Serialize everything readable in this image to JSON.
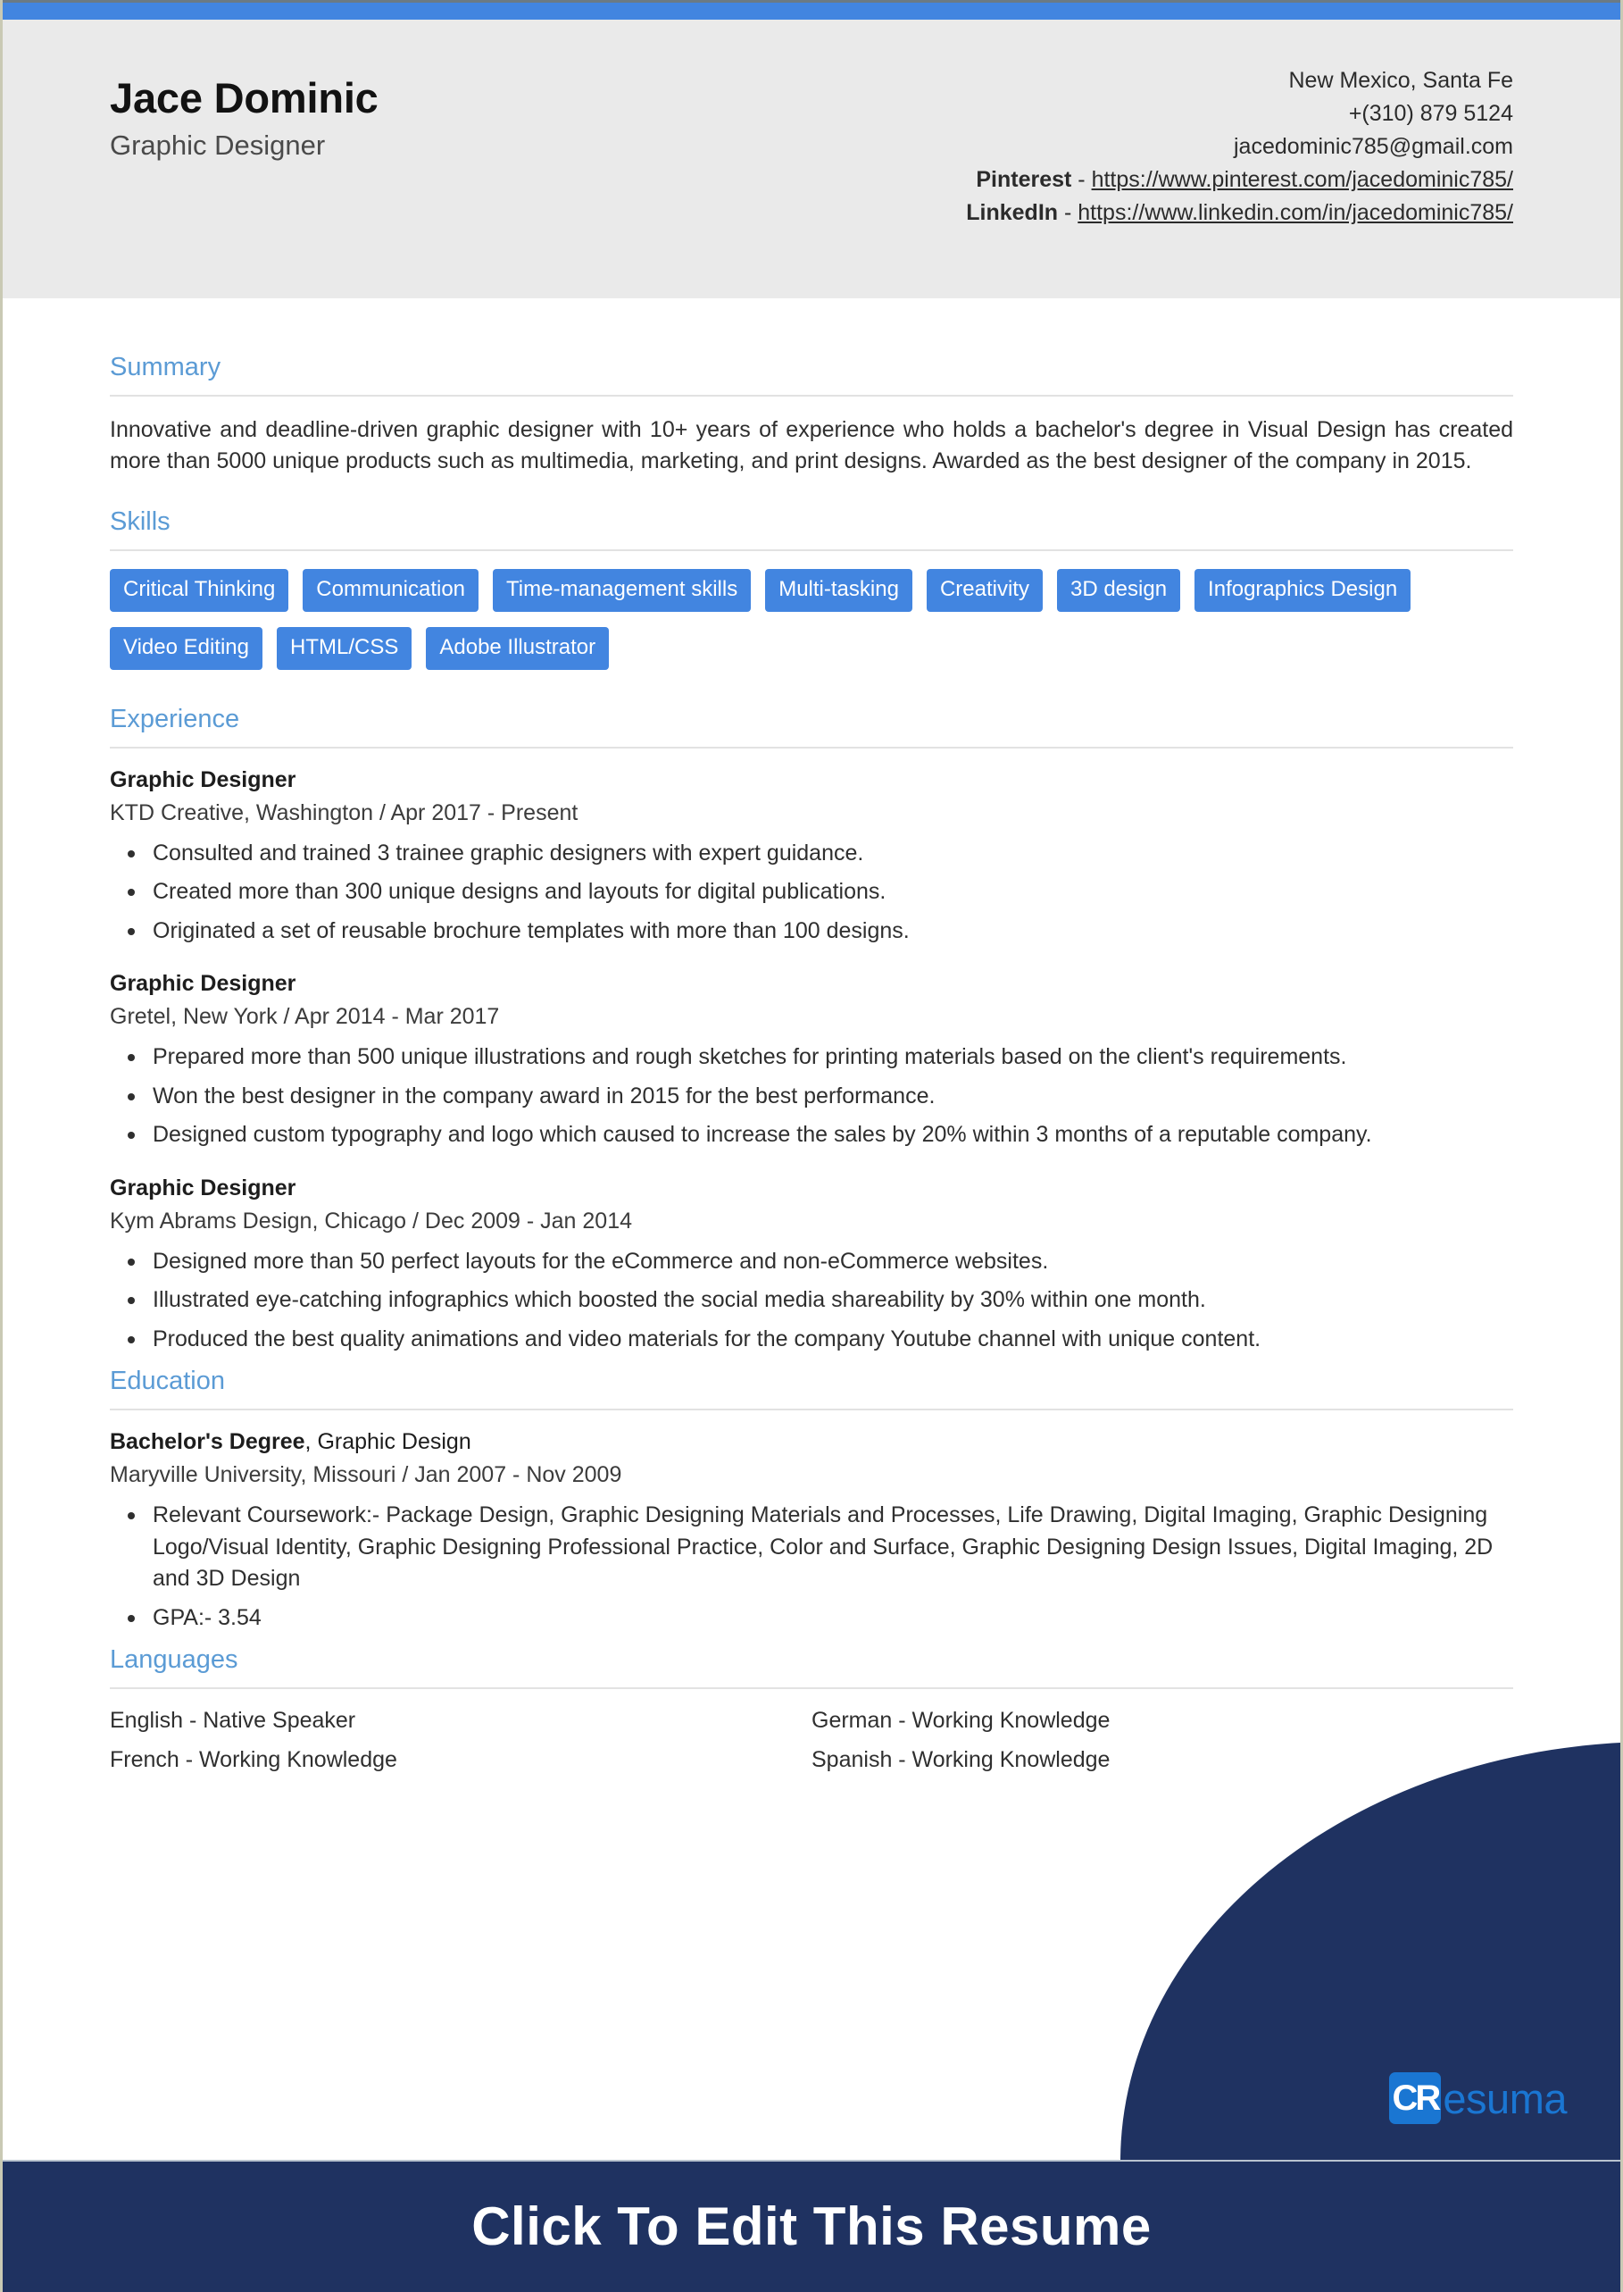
{
  "theme": {
    "accent_blue": "#4285e0",
    "heading_blue": "#5b9bd5",
    "navy": "#1f3261",
    "logo_blue": "#1a76d2",
    "header_band_bg": "#eaeaea"
  },
  "header": {
    "full_name": "Jace Dominic",
    "job_title": "Graphic Designer",
    "location": "New Mexico, Santa Fe",
    "phone": "+(310) 879 5124",
    "email": "jacedominic785@gmail.com",
    "pinterest_label": "Pinterest",
    "pinterest_url": "https://www.pinterest.com/jacedominic785/",
    "linkedin_label": "LinkedIn",
    "linkedin_url": "https://www.linkedin.com/in/jacedominic785/",
    "separator": " - "
  },
  "summary": {
    "heading": "Summary",
    "text": "Innovative and deadline-driven graphic designer with 10+ years of experience who holds a bachelor's degree in Visual Design has created more than 5000 unique products such as multimedia, marketing, and print designs. Awarded as the best designer of the company in 2015."
  },
  "skills": {
    "heading": "Skills",
    "items": [
      "Critical Thinking",
      "Communication",
      "Time-management skills",
      "Multi-tasking",
      "Creativity",
      "3D design",
      "Infographics Design",
      "Video Editing",
      "HTML/CSS",
      "Adobe Illustrator"
    ]
  },
  "experience": {
    "heading": "Experience",
    "entries": [
      {
        "role": "Graphic Designer",
        "meta": "KTD Creative, Washington / Apr 2017 - Present",
        "bullets": [
          "Consulted and trained 3 trainee graphic designers with expert guidance.",
          "Created more than 300 unique designs and layouts for digital publications.",
          "Originated a set of reusable brochure templates with more than 100 designs."
        ]
      },
      {
        "role": "Graphic Designer",
        "meta": "Gretel, New York / Apr 2014 - Mar 2017",
        "bullets": [
          "Prepared more than 500 unique illustrations and rough sketches for printing materials based on the client's requirements.",
          "Won the best designer in the company award in 2015 for the best performance.",
          "Designed custom typography and logo which caused to increase the sales by 20% within 3 months of a reputable company."
        ]
      },
      {
        "role": "Graphic Designer",
        "meta": "Kym Abrams Design, Chicago / Dec 2009 - Jan 2014",
        "bullets": [
          "Designed more than 50 perfect layouts for the eCommerce and non-eCommerce websites.",
          "Illustrated eye-catching infographics which boosted the social media shareability by 30% within one month.",
          "Produced the best quality animations and video materials for the company Youtube channel with unique content."
        ]
      }
    ]
  },
  "education": {
    "heading": "Education",
    "entries": [
      {
        "degree_bold": "Bachelor's Degree",
        "degree_rest": ", Graphic Design",
        "meta": "Maryville University, Missouri / Jan 2007 - Nov 2009",
        "bullets": [
          "Relevant Coursework:- Package Design, Graphic Designing Materials and Processes, Life Drawing, Digital Imaging, Graphic Designing Logo/Visual Identity, Graphic Designing Professional Practice, Color and Surface, Graphic Designing Design Issues, Digital Imaging, 2D and 3D Design",
          "GPA:- 3.54"
        ]
      }
    ]
  },
  "languages": {
    "heading": "Languages",
    "items": [
      "English - Native Speaker",
      "German - Working Knowledge",
      "French - Working Knowledge",
      "Spanish - Working Knowledge"
    ]
  },
  "branding": {
    "logo_mark_text": "CR",
    "logo_word": "esuma"
  },
  "cta": {
    "text": "Click To Edit This Resume"
  }
}
